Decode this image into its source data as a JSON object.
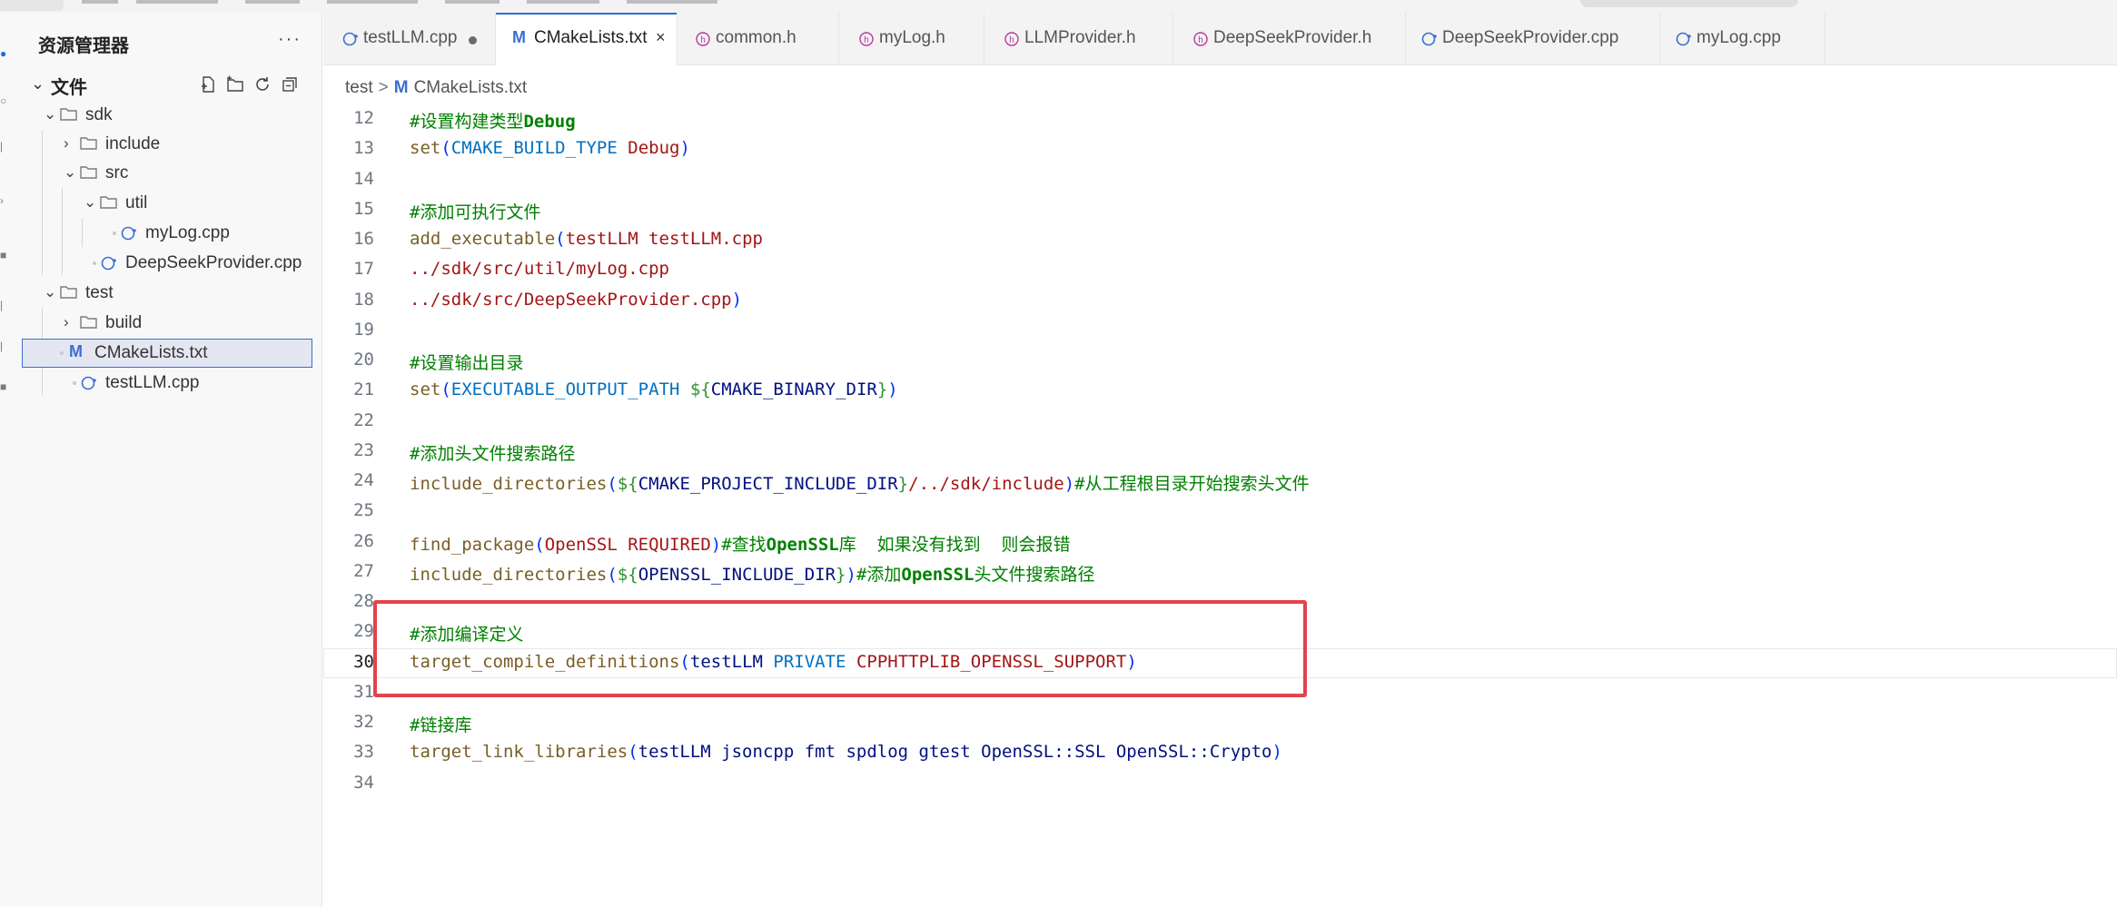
{
  "sidebar": {
    "title": "资源管理器",
    "more": "···",
    "section": "文件",
    "tree": [
      {
        "label": "sdk",
        "kind": "folder",
        "open": true
      },
      {
        "label": "include",
        "kind": "folder",
        "open": false
      },
      {
        "label": "src",
        "kind": "folder",
        "open": true
      },
      {
        "label": "util",
        "kind": "folder",
        "open": true
      },
      {
        "label": "myLog.cpp",
        "kind": "cpp"
      },
      {
        "label": "DeepSeekProvider.cpp",
        "kind": "cpp"
      },
      {
        "label": "test",
        "kind": "folder",
        "open": true
      },
      {
        "label": "build",
        "kind": "folder",
        "open": false
      },
      {
        "label": "CMakeLists.txt",
        "kind": "cmake",
        "selected": true
      },
      {
        "label": "testLLM.cpp",
        "kind": "cpp"
      }
    ]
  },
  "tabs": [
    {
      "label": "testLLM.cpp",
      "icon": "cpp-file-icon",
      "modified": true
    },
    {
      "label": "CMakeLists.txt",
      "icon": "cmake-file-icon",
      "active": true
    },
    {
      "label": "common.h",
      "icon": "header-file-icon"
    },
    {
      "label": "myLog.h",
      "icon": "header-file-icon"
    },
    {
      "label": "LLMProvider.h",
      "icon": "header-file-icon"
    },
    {
      "label": "DeepSeekProvider.h",
      "icon": "header-file-icon"
    },
    {
      "label": "DeepSeekProvider.cpp",
      "icon": "cpp-file-icon"
    },
    {
      "label": "myLog.cpp",
      "icon": "cpp-file-icon"
    }
  ],
  "breadcrumb": {
    "folder": "test",
    "sep": ">",
    "file": "CMakeLists.txt"
  },
  "editor": {
    "current_line": 30,
    "lines": [
      {
        "n": "12",
        "tokens": [
          {
            "t": "#设置构建类型",
            "c": "comment"
          },
          {
            "t": "Debug",
            "c": "comment-bold"
          }
        ]
      },
      {
        "n": "13",
        "tokens": [
          {
            "t": "set",
            "c": "func"
          },
          {
            "t": "(",
            "c": "paren"
          },
          {
            "t": "CMAKE_BUILD_TYPE",
            "c": "var"
          },
          {
            "t": " ",
            "c": "plain"
          },
          {
            "t": "Debug",
            "c": "arg"
          },
          {
            "t": ")",
            "c": "paren"
          }
        ]
      },
      {
        "n": "14",
        "tokens": []
      },
      {
        "n": "15",
        "tokens": [
          {
            "t": "#添加可执行文件",
            "c": "comment"
          }
        ]
      },
      {
        "n": "16",
        "tokens": [
          {
            "t": "add_executable",
            "c": "func"
          },
          {
            "t": "(",
            "c": "paren"
          },
          {
            "t": "testLLM testLLM.cpp",
            "c": "arg"
          }
        ]
      },
      {
        "n": "17",
        "tokens": [
          {
            "t": "../sdk/src/util/myLog.cpp",
            "c": "arg"
          }
        ]
      },
      {
        "n": "18",
        "tokens": [
          {
            "t": "../sdk/src/DeepSeekProvider.cpp",
            "c": "arg"
          },
          {
            "t": ")",
            "c": "paren"
          }
        ]
      },
      {
        "n": "19",
        "tokens": []
      },
      {
        "n": "20",
        "tokens": [
          {
            "t": "#设置输出目录",
            "c": "comment"
          }
        ]
      },
      {
        "n": "21",
        "tokens": [
          {
            "t": "set",
            "c": "func"
          },
          {
            "t": "(",
            "c": "paren"
          },
          {
            "t": "EXECUTABLE_OUTPUT_PATH",
            "c": "var"
          },
          {
            "t": " ",
            "c": "plain"
          },
          {
            "t": "${",
            "c": "paren2"
          },
          {
            "t": "CMAKE_BINARY_DIR",
            "c": "var2"
          },
          {
            "t": "}",
            "c": "paren2"
          },
          {
            "t": ")",
            "c": "paren"
          }
        ]
      },
      {
        "n": "22",
        "tokens": []
      },
      {
        "n": "23",
        "tokens": [
          {
            "t": "#添加头文件搜索路径",
            "c": "comment"
          }
        ]
      },
      {
        "n": "24",
        "tokens": [
          {
            "t": "include_directories",
            "c": "func"
          },
          {
            "t": "(",
            "c": "paren"
          },
          {
            "t": "${",
            "c": "paren2"
          },
          {
            "t": "CMAKE_PROJECT_INCLUDE_DIR",
            "c": "var2"
          },
          {
            "t": "}",
            "c": "paren2"
          },
          {
            "t": "/../sdk/include",
            "c": "arg"
          },
          {
            "t": ")",
            "c": "paren"
          },
          {
            "t": "#从工程根目录开始搜索头文件",
            "c": "comment"
          }
        ]
      },
      {
        "n": "25",
        "tokens": []
      },
      {
        "n": "26",
        "tokens": [
          {
            "t": "find_package",
            "c": "func"
          },
          {
            "t": "(",
            "c": "paren"
          },
          {
            "t": "OpenSSL REQUIRED",
            "c": "arg"
          },
          {
            "t": ")",
            "c": "paren"
          },
          {
            "t": "#查找",
            "c": "comment"
          },
          {
            "t": "OpenSSL",
            "c": "comment-bold"
          },
          {
            "t": "库  如果没有找到  则会报错",
            "c": "comment"
          }
        ]
      },
      {
        "n": "27",
        "tokens": [
          {
            "t": "include_directories",
            "c": "func"
          },
          {
            "t": "(",
            "c": "paren"
          },
          {
            "t": "${",
            "c": "paren2"
          },
          {
            "t": "OPENSSL_INCLUDE_DIR",
            "c": "var2"
          },
          {
            "t": "}",
            "c": "paren2"
          },
          {
            "t": ")",
            "c": "paren"
          },
          {
            "t": "#添加",
            "c": "comment"
          },
          {
            "t": "OpenSSL",
            "c": "comment-bold"
          },
          {
            "t": "头文件搜索路径",
            "c": "comment"
          }
        ]
      },
      {
        "n": "28",
        "tokens": []
      },
      {
        "n": "29",
        "tokens": [
          {
            "t": "#添加编译定义",
            "c": "comment"
          }
        ]
      },
      {
        "n": "30",
        "tokens": [
          {
            "t": "target_compile_definitions",
            "c": "func"
          },
          {
            "t": "(",
            "c": "paren"
          },
          {
            "t": "testLLM",
            "c": "arg2"
          },
          {
            "t": " ",
            "c": "plain"
          },
          {
            "t": "PRIVATE",
            "c": "var"
          },
          {
            "t": " ",
            "c": "plain"
          },
          {
            "t": "CPPHTTPLIB_OPENSSL_SUPPORT",
            "c": "arg"
          },
          {
            "t": ")",
            "c": "paren"
          }
        ]
      },
      {
        "n": "31",
        "tokens": []
      },
      {
        "n": "32",
        "tokens": [
          {
            "t": "#链接库",
            "c": "comment"
          }
        ]
      },
      {
        "n": "33",
        "tokens": [
          {
            "t": "target_link_libraries",
            "c": "func"
          },
          {
            "t": "(",
            "c": "paren"
          },
          {
            "t": "testLLM jsoncpp fmt spdlog gtest OpenSSL::SSL OpenSSL::Crypto",
            "c": "arg2"
          },
          {
            "t": ")",
            "c": "paren"
          }
        ]
      },
      {
        "n": "34",
        "tokens": []
      }
    ]
  },
  "colors": {
    "comment": "#008000",
    "func": "#795e26",
    "paren": "#0431fa",
    "paren2": "#319331",
    "var": "#0070c1",
    "var2": "#001080",
    "arg": "#a31515",
    "arg2": "#001080",
    "highlight_border": "#e4424d",
    "accent": "#2f6bd6"
  }
}
